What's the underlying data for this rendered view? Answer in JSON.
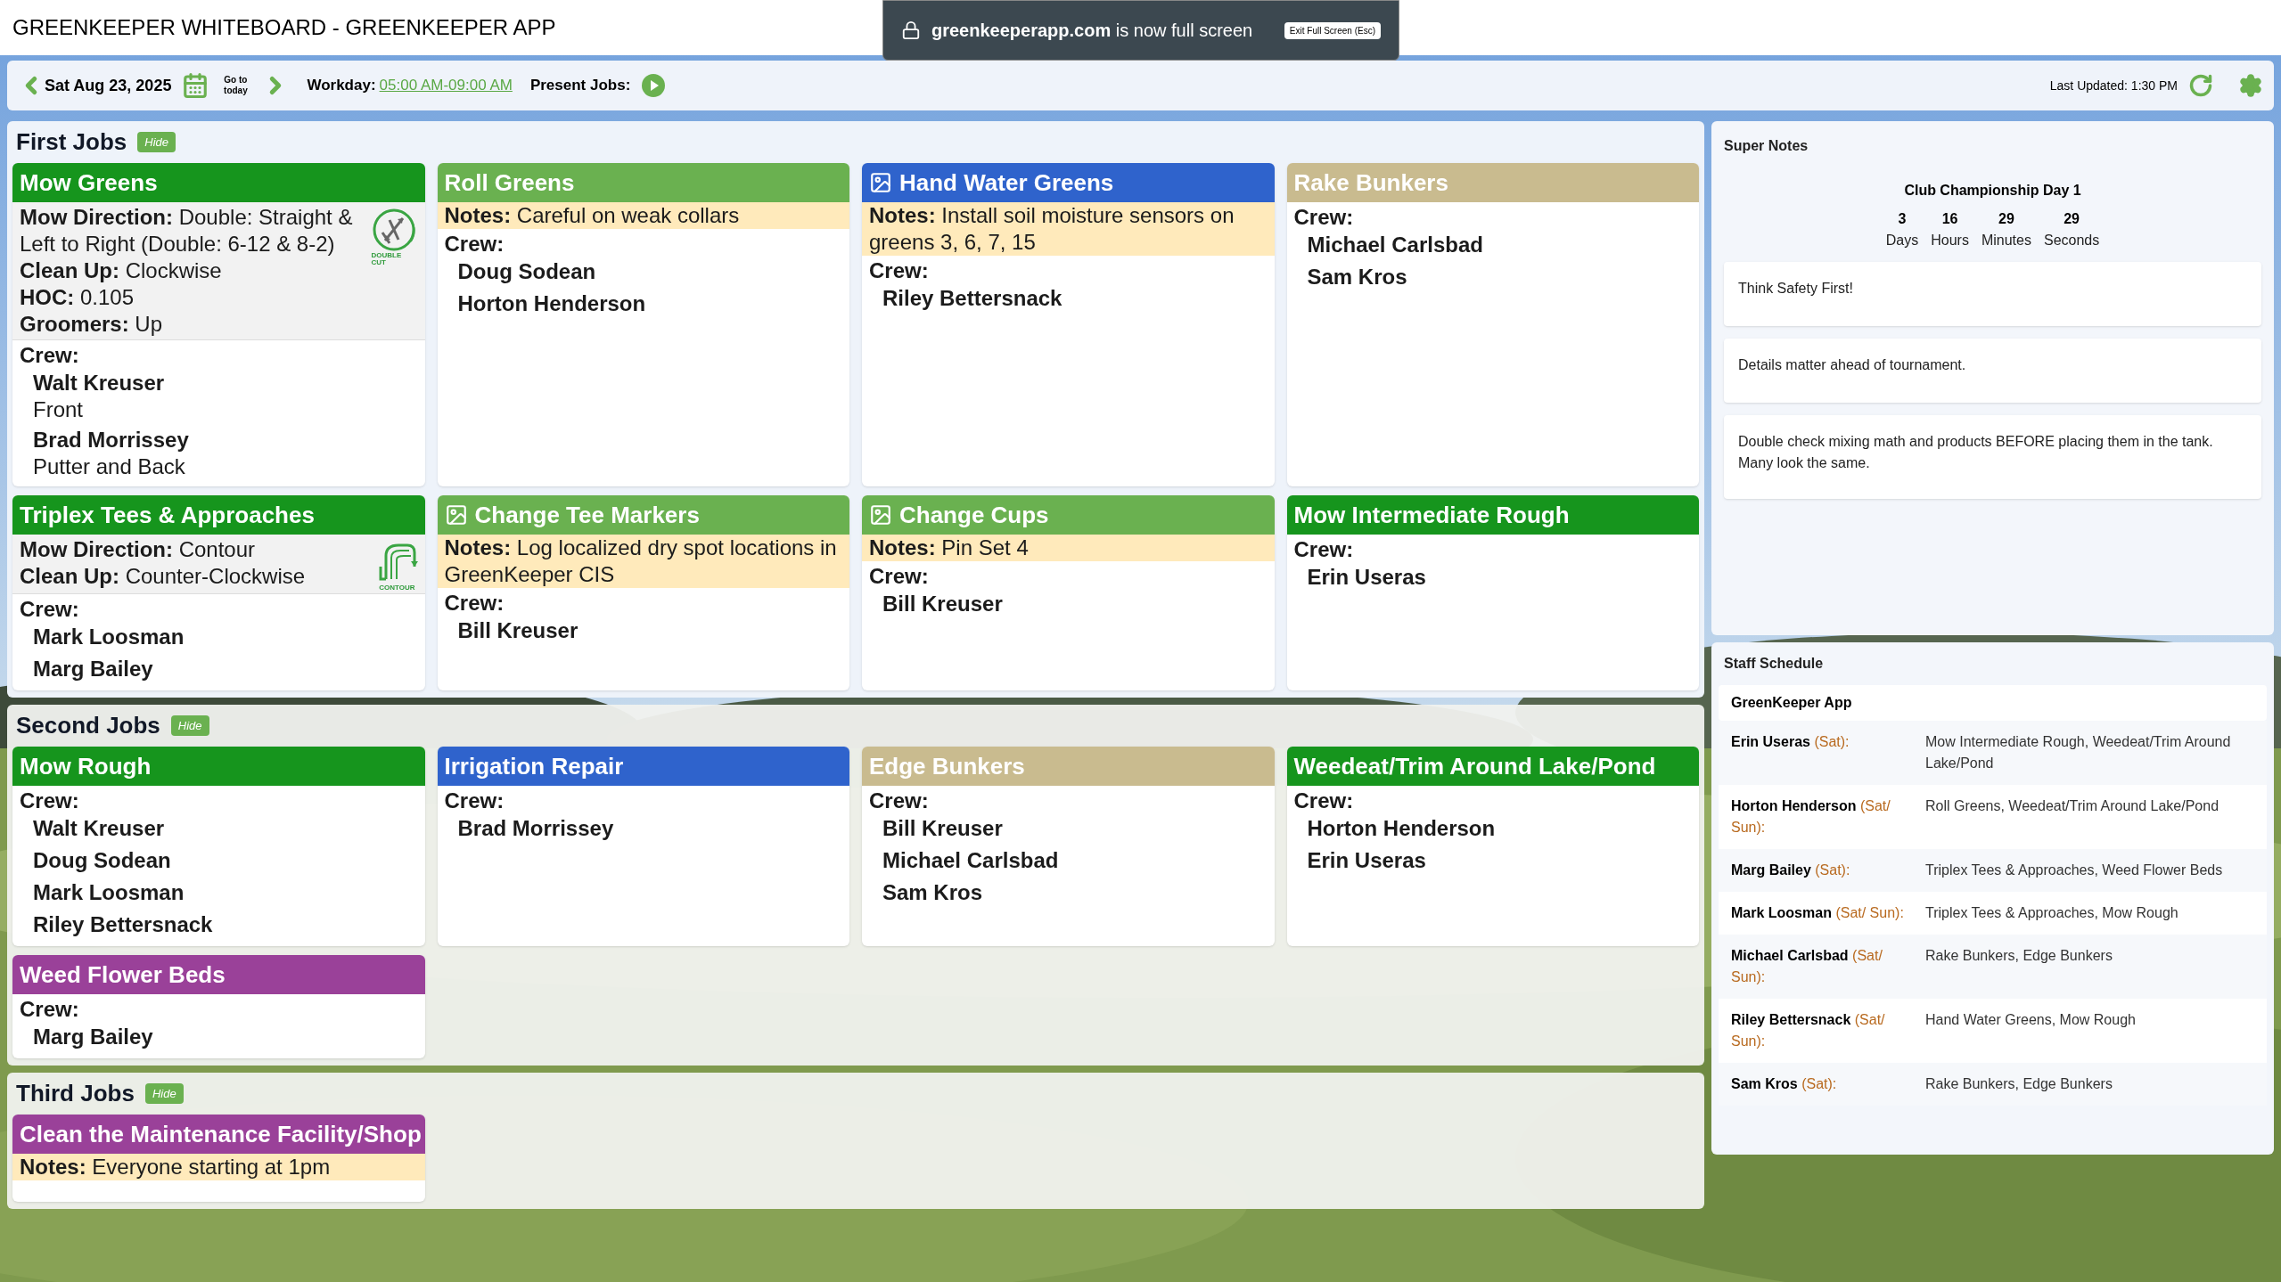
{
  "window": {
    "title": "GREENKEEPER WHITEBOARD - GREENKEEPER APP"
  },
  "fullscreen_notice": {
    "domain": "greenkeeperapp.com",
    "text": "is now full screen",
    "button": "Exit Full Screen (Esc)"
  },
  "toolbar": {
    "date": "Sat Aug 23, 2025",
    "go_to_today": "Go to today",
    "workday_label": "Workday:",
    "workday": "05:00 AM-09:00 AM",
    "present_jobs": "Present Jobs:",
    "last_updated": "Last Updated: 1:30 PM"
  },
  "sections": [
    {
      "title": "First Jobs",
      "hide": "Hide",
      "jobs": [
        {
          "title": "Mow Greens",
          "color": "#16951d",
          "photo": false,
          "details": [
            "**Mow Direction:** Double: Straight & Left to Right (Double: 6-12 & 8-2)",
            "**Clean Up:** Clockwise",
            "**HOC:** 0.105",
            "**Groomers:** Up"
          ],
          "pattern": {
            "kind": "double_cut",
            "caption": "DOUBLE CUT"
          },
          "crew_label": "Crew:",
          "crew": [
            {
              "name": "Walt Kreuser",
              "role": "Front"
            },
            {
              "name": "Brad Morrissey",
              "role": "Putter and Back"
            }
          ]
        },
        {
          "title": "Roll Greens",
          "color": "#6ab150",
          "photo": false,
          "notes": "**Notes:** Careful on weak collars",
          "crew_label": "Crew:",
          "crew": [
            {
              "name": "Doug Sodean"
            },
            {
              "name": "Horton Henderson"
            }
          ]
        },
        {
          "title": "Hand Water Greens",
          "color": "#2f63cc",
          "photo": true,
          "notes": "**Notes:** Install soil moisture sensors on greens 3, 6, 7, 15",
          "crew_label": "Crew:",
          "crew": [
            {
              "name": "Riley Bettersnack"
            }
          ]
        },
        {
          "title": "Rake Bunkers",
          "color": "#c9bb8f",
          "photo": false,
          "crew_label": "Crew:",
          "crew": [
            {
              "name": "Michael Carlsbad"
            },
            {
              "name": "Sam Kros"
            }
          ]
        },
        {
          "title": "Triplex Tees & Approaches",
          "color": "#16951d",
          "photo": false,
          "details": [
            "**Mow Direction:** Contour",
            "**Clean Up:** Counter-Clockwise"
          ],
          "pattern": {
            "kind": "contour",
            "caption": "CONTOUR"
          },
          "crew_label": "Crew:",
          "crew": [
            {
              "name": "Mark Loosman"
            },
            {
              "name": "Marg Bailey"
            }
          ]
        },
        {
          "title": "Change Tee Markers",
          "color": "#6ab150",
          "photo": true,
          "notes": "**Notes:** Log localized dry spot locations in GreenKeeper CIS",
          "crew_label": "Crew:",
          "crew": [
            {
              "name": "Bill Kreuser"
            }
          ]
        },
        {
          "title": "Change Cups",
          "color": "#6ab150",
          "photo": true,
          "notes": "**Notes:** Pin Set 4",
          "crew_label": "Crew:",
          "crew": [
            {
              "name": "Bill Kreuser"
            }
          ]
        },
        {
          "title": "Mow Intermediate Rough",
          "color": "#16951d",
          "photo": false,
          "crew_label": "Crew:",
          "crew": [
            {
              "name": "Erin Useras"
            }
          ]
        }
      ]
    },
    {
      "title": "Second Jobs",
      "hide": "Hide",
      "jobs": [
        {
          "title": "Mow Rough",
          "color": "#16951d",
          "photo": false,
          "crew_label": "Crew:",
          "crew": [
            {
              "name": "Walt Kreuser"
            },
            {
              "name": "Doug Sodean"
            },
            {
              "name": "Mark Loosman"
            },
            {
              "name": "Riley Bettersnack"
            }
          ]
        },
        {
          "title": "Irrigation Repair",
          "color": "#2f63cc",
          "photo": false,
          "crew_label": "Crew:",
          "crew": [
            {
              "name": "Brad Morrissey"
            }
          ]
        },
        {
          "title": "Edge Bunkers",
          "color": "#c9bb8f",
          "photo": false,
          "crew_label": "Crew:",
          "crew": [
            {
              "name": "Bill Kreuser"
            },
            {
              "name": "Michael Carlsbad"
            },
            {
              "name": "Sam Kros"
            }
          ]
        },
        {
          "title": "Weedeat/Trim Around Lake/Pond",
          "color": "#16951d",
          "photo": false,
          "crew_label": "Crew:",
          "crew": [
            {
              "name": "Horton Henderson"
            },
            {
              "name": "Erin Useras"
            }
          ]
        },
        {
          "title": "Weed Flower Beds",
          "color": "#9a4199",
          "photo": false,
          "crew_label": "Crew:",
          "crew": [
            {
              "name": "Marg Bailey"
            }
          ]
        }
      ]
    },
    {
      "title": "Third Jobs",
      "hide": "Hide",
      "jobs": [
        {
          "title": "Clean the Maintenance Facility/Shop",
          "color": "#9a4199",
          "photo": false,
          "notes": "**Notes:** Everyone starting at 1pm"
        }
      ]
    }
  ],
  "super_notes": {
    "title": "Super Notes",
    "event": "Club Championship Day 1",
    "countdown": [
      {
        "value": "3",
        "unit": "Days"
      },
      {
        "value": "16",
        "unit": "Hours"
      },
      {
        "value": "29",
        "unit": "Minutes"
      },
      {
        "value": "29",
        "unit": "Seconds"
      }
    ],
    "notes": [
      "Think Safety First!",
      "Details matter ahead of tournament.",
      "Double check mixing math and products BEFORE placing them in the tank. Many look the same."
    ]
  },
  "staff_schedule": {
    "title": "Staff Schedule",
    "group": "GreenKeeper App",
    "rows": [
      {
        "name": "Erin Useras",
        "days": "(Sat):",
        "jobs": "Mow Intermediate Rough, Weedeat/Trim Around Lake/Pond"
      },
      {
        "name": "Horton Henderson",
        "days": "(Sat/ Sun):",
        "jobs": "Roll Greens, Weedeat/Trim Around Lake/Pond"
      },
      {
        "name": "Marg Bailey",
        "days": "(Sat):",
        "jobs": "Triplex Tees & Approaches, Weed Flower Beds"
      },
      {
        "name": "Mark Loosman",
        "days": "(Sat/ Sun):",
        "jobs": "Triplex Tees & Approaches, Mow Rough"
      },
      {
        "name": "Michael Carlsbad",
        "days": "(Sat/ Sun):",
        "jobs": "Rake Bunkers, Edge Bunkers"
      },
      {
        "name": "Riley Bettersnack",
        "days": "(Sat/ Sun):",
        "jobs": "Hand Water Greens, Mow Rough"
      },
      {
        "name": "Sam Kros",
        "days": "(Sat):",
        "jobs": "Rake Bunkers, Edge Bunkers"
      }
    ]
  }
}
